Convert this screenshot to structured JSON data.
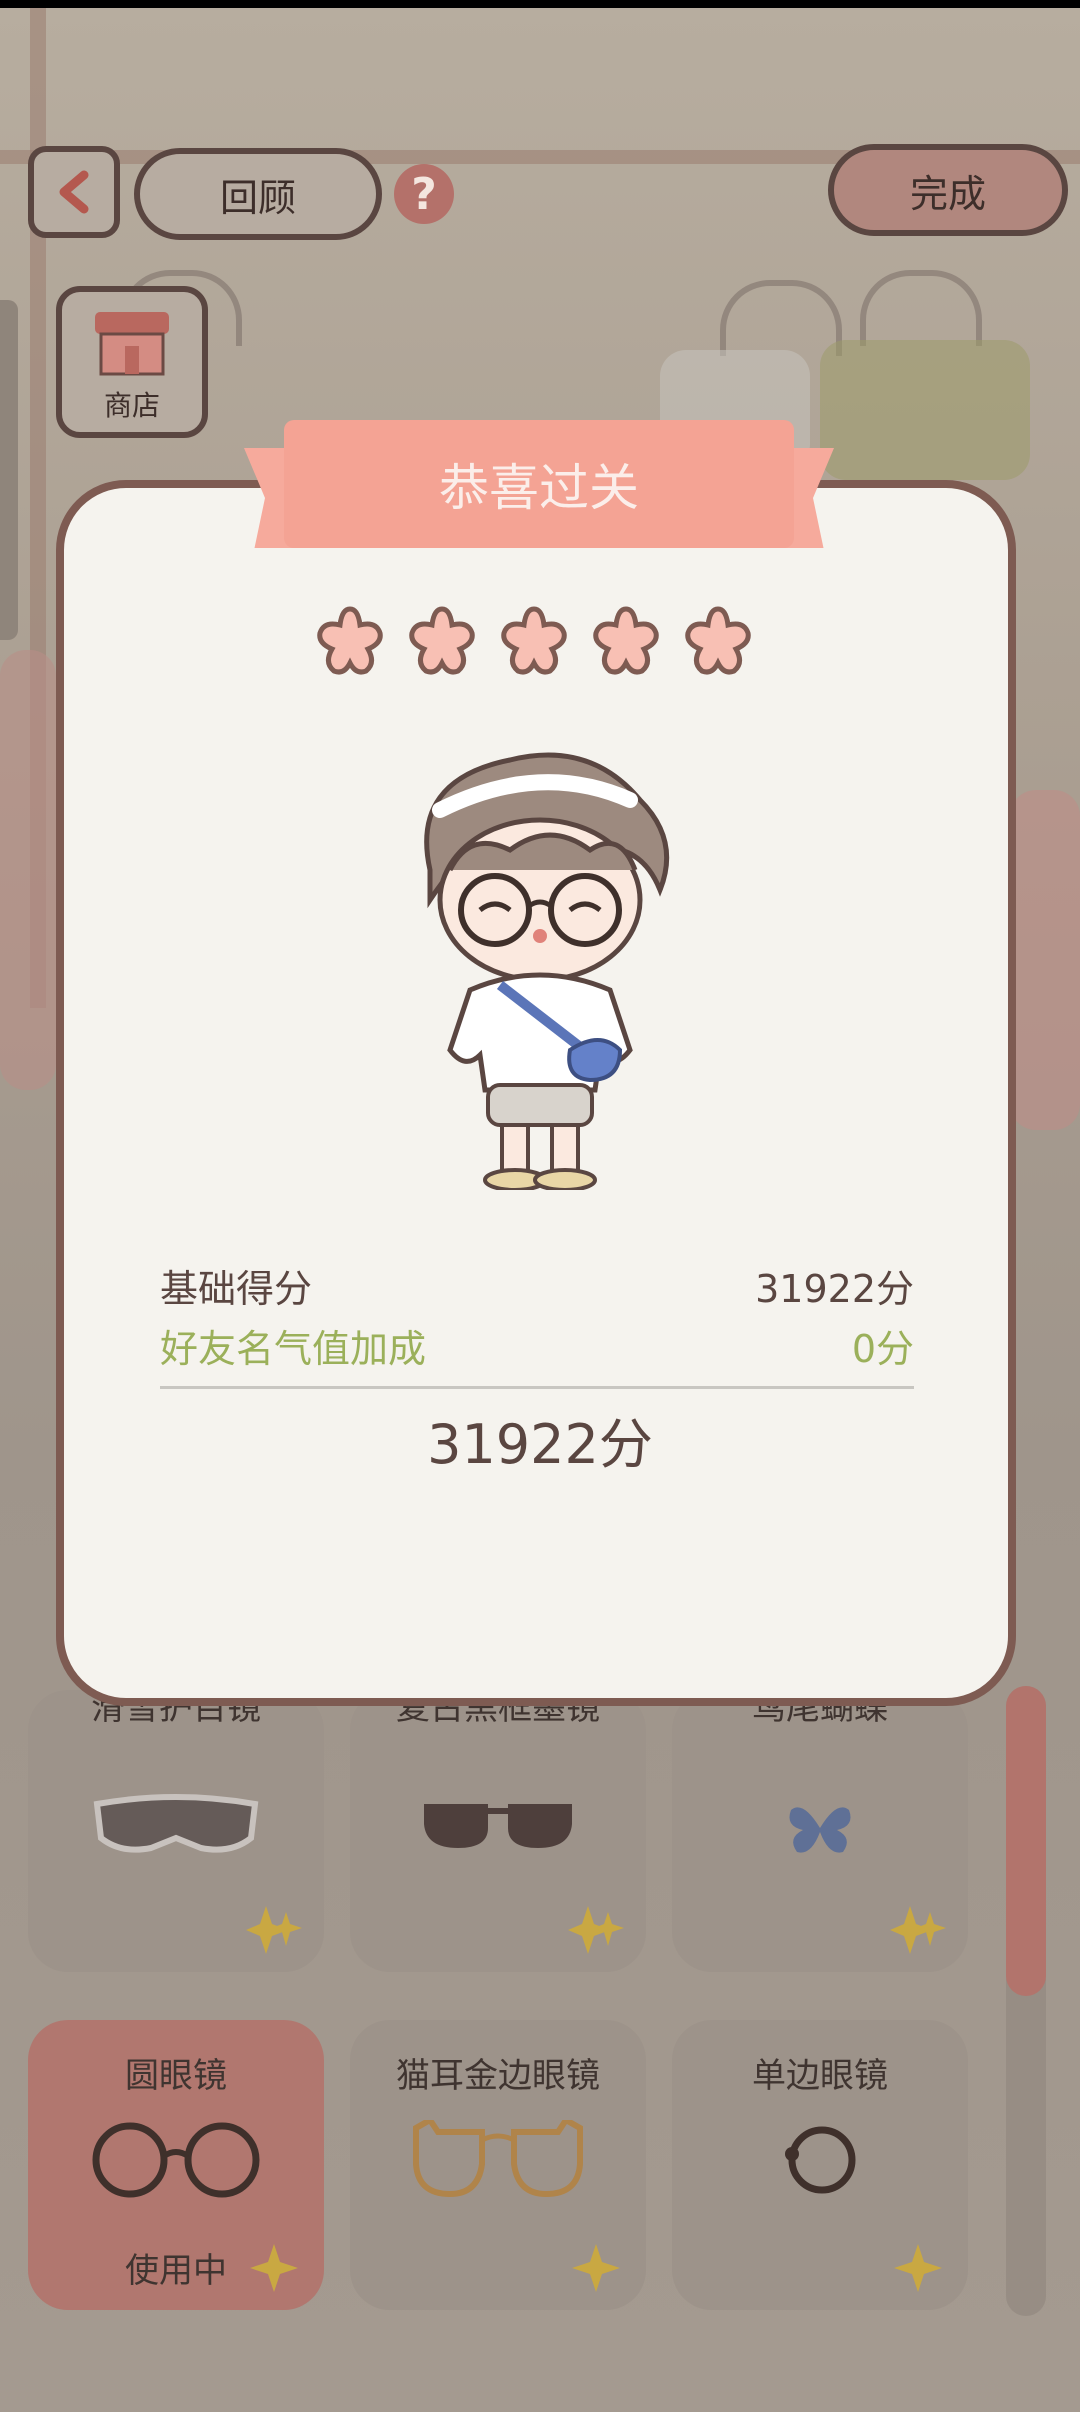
{
  "topbar": {
    "back_label": "<",
    "review_label": "回顾",
    "help_label": "?",
    "done_label": "完成"
  },
  "shop": {
    "label": "商店"
  },
  "result": {
    "title": "恭喜过关",
    "stars": 5,
    "base_score_label": "基础得分",
    "base_score_value": "31922分",
    "bonus_label": "好友名气值加成",
    "bonus_value": "0分",
    "total": "31922分"
  },
  "items": [
    {
      "label": "滑雪护目镜"
    },
    {
      "label": "复古黑框墨镜"
    },
    {
      "label": "鸢尾蝴蝶"
    },
    {
      "label": "圆眼镜",
      "status": "使用中"
    },
    {
      "label": "猫耳金边眼镜"
    },
    {
      "label": "单边眼镜"
    }
  ],
  "colors": {
    "accent": "#f4a394",
    "frame": "#7e5b52",
    "bonus": "#9bb05a",
    "text": "#5a4641"
  }
}
